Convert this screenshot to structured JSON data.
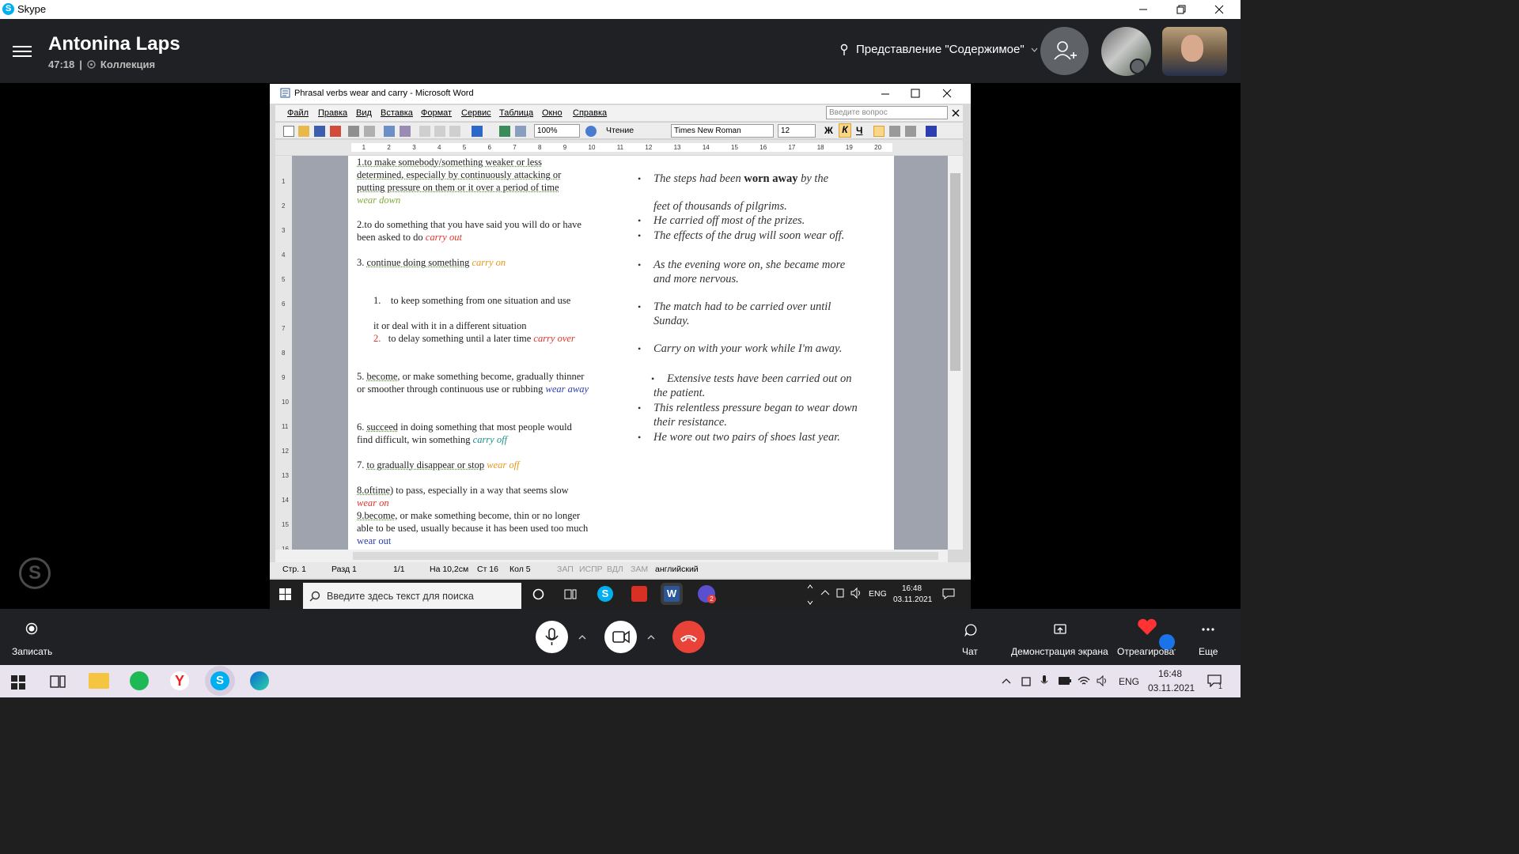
{
  "app": {
    "title": "Skype"
  },
  "call": {
    "name": "Antonina Laps",
    "duration": "47:18",
    "separator": "|",
    "collection": "Коллекция",
    "view_mode": "Представление \"Содержимое\""
  },
  "word": {
    "title": "Phrasal verbs  wear and carry - Microsoft Word",
    "menu": [
      "Файл",
      "Правка",
      "Вид",
      "Вставка",
      "Формат",
      "Сервис",
      "Таблица",
      "Окно",
      "Справка"
    ],
    "help_placeholder": "Введите вопрос",
    "zoom": "100%",
    "reading": "Чтение",
    "font": "Times New Roman",
    "font_size": "12",
    "bold": "Ж",
    "italic": "К",
    "underline": "Ч",
    "ruler_ticks": [
      "1",
      "2",
      "3",
      "4",
      "5",
      "6",
      "7",
      "8",
      "9",
      "10",
      "11",
      "12",
      "13",
      "14",
      "15",
      "16",
      "17",
      "18",
      "19",
      "20"
    ],
    "vruler_ticks": [
      "1",
      "2",
      "3",
      "4",
      "5",
      "6",
      "7",
      "8",
      "9",
      "10",
      "11",
      "12",
      "13",
      "14",
      "15",
      "16"
    ],
    "left": {
      "d1": "1.to make somebody/something weaker or less determined, especially by continuously attacking or putting pressure on them or it over a period of time",
      "a1": "wear  down",
      "d2": "2.to do something that you have said you will do or have been asked to do",
      "a2": "carry out",
      "d3_num": "3.",
      "d3": "continue doing something",
      "a3": "carry on",
      "d4_num": "1.",
      "d4a": "to keep something from one situation and use",
      "d4b": "it or deal with it in a different situation",
      "d4c_num": "2.",
      "d4c": "to delay something until a later time",
      "a4": "carry over",
      "d5_num": "5.",
      "d5_word": "become",
      "d5": ", or make something become, gradually thinner or smoother through continuous use or rubbing",
      "a5": "wear away",
      "d6_num": "6.",
      "d6_word": "succeed",
      "d6": " in doing something that most people would find difficult, win something",
      "a6": "carry off",
      "d7_num": "7.",
      "d7": "to gradually disappear or stop",
      "a7": "wear off",
      "d8_word": "8.oftime)",
      "d8": " to pass, especially in a way that seems slow",
      "a8": "wear on",
      "d9_word": "9.become",
      "d9": ", or make something become, thin or no longer able to be used, usually because it has been used too much",
      "a9": "wear out"
    },
    "right": {
      "s1a": "The steps had been",
      "s1b": "worn away",
      "s1c": "by the",
      "s1d": "feet of thousands of pilgrims.",
      "s2": "He carried off most of the prizes.",
      "s3": "The effects of the drug will soon wear off.",
      "s4": "As the evening wore on, she became more and more nervous.",
      "s5": "The match had to be carried over until Sunday.",
      "s6": "Carry on with your work while I'm away.",
      "s7": "Extensive tests have been carried out on the patient.",
      "s8": "This relentless pressure began to wear down their resistance.",
      "s9": "He wore out two pairs of shoes last year."
    },
    "status": {
      "page": "Стр. 1",
      "section": "Разд 1",
      "pages": "1/1",
      "at": "На 10,2см",
      "line": "Ст 16",
      "col": "Кол 5",
      "rec": "ЗАП",
      "trk": "ИСПР",
      "ext": "ВДЛ",
      "ovr": "ЗАМ",
      "lang": "английский"
    },
    "taskbar": {
      "search": "Введите здесь текст для поиска",
      "lang": "ENG",
      "time": "16:48",
      "date": "03.11.2021",
      "badge": "2"
    }
  },
  "controls": {
    "record": "Записать",
    "chat": "Чат",
    "share": "Демонстрация экрана",
    "react": "Отреагировать",
    "more": "Еще"
  },
  "host_taskbar": {
    "lang": "ENG",
    "time": "16:48",
    "date": "03.11.2021",
    "notif": "1"
  },
  "colors": {
    "skype_blue": "#00aff0",
    "hangup_red": "#e84239",
    "heart": "#ff3333",
    "call_bg": "#202124",
    "answer_green": "#7fae3a",
    "answer_red": "#e0352b",
    "answer_orange": "#e6971d",
    "answer_blue": "#2a3fb0",
    "answer_teal": "#1f8f8a"
  }
}
